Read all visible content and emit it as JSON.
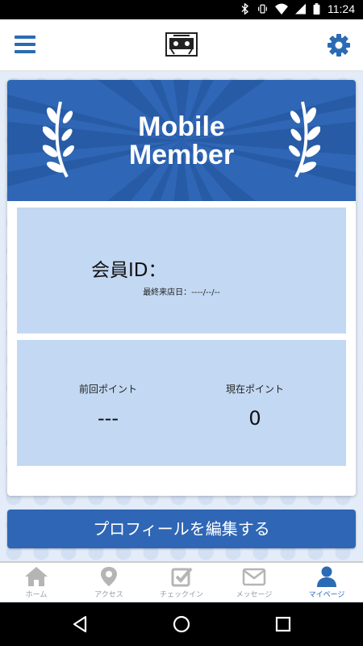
{
  "status_bar": {
    "time": "11:24",
    "icons": [
      "bluetooth-icon",
      "vibrate-icon",
      "wifi-icon",
      "signal-icon",
      "battery-icon"
    ]
  },
  "header": {
    "menu_icon": "hamburger-menu-icon",
    "logo_icon": "store-logo-icon",
    "settings_icon": "gear-icon"
  },
  "banner": {
    "title_line1": "Mobile",
    "title_line2": "Member",
    "decoration": "laurel-icon"
  },
  "member": {
    "id_label": "会員ID：",
    "last_visit_label": "最終来店日：",
    "last_visit_value": "----/--/--"
  },
  "points": {
    "previous": {
      "label": "前回ポイント",
      "value": "---"
    },
    "current": {
      "label": "現在ポイント",
      "value": "0"
    }
  },
  "edit_button": {
    "label": "プロフィールを編集する"
  },
  "tabs": [
    {
      "label": "ホーム",
      "icon": "home-icon",
      "active": false
    },
    {
      "label": "アクセス",
      "icon": "map-pin-icon",
      "active": false
    },
    {
      "label": "チェックイン",
      "icon": "checkin-icon",
      "active": false
    },
    {
      "label": "メッセージ",
      "icon": "envelope-icon",
      "active": false
    },
    {
      "label": "マイページ",
      "icon": "user-icon",
      "active": true
    }
  ],
  "colors": {
    "primary": "#2f66b5",
    "panel": "#c3d8f2",
    "inactive": "#b5b5b5"
  }
}
